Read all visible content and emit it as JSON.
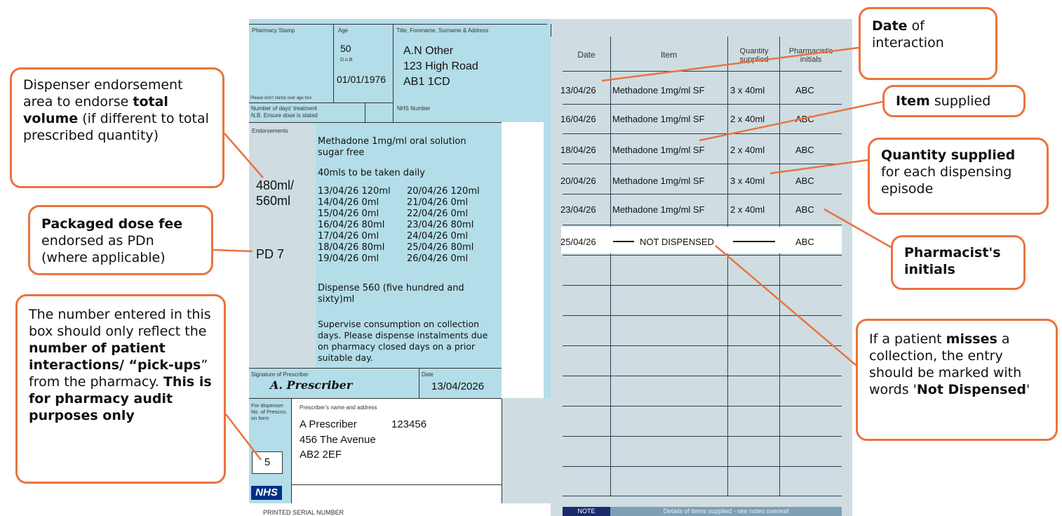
{
  "form": {
    "pharmacy_stamp_label": "Pharmacy Stamp",
    "age_label": "Age",
    "age": "50",
    "dob_label": "D.o.B",
    "dob": "01/01/1976",
    "stamp_note": "Please don't stamp over age box",
    "patient_label": "Title, Forename, Surname & Address",
    "patient_name": "A.N Other",
    "patient_addr1": "123 High Road",
    "patient_addr2": "AB1 1CD",
    "days_label_1": "Number of days' treatment",
    "days_label_2": "N.B. Ensure dose is stated",
    "nhs_number_label": "NHS Number",
    "endorsements_label": "Endorsements",
    "endorse_volume_1": "480ml/",
    "endorse_volume_2": "560ml",
    "endorse_pd": "PD 7",
    "rx_drug": "Methadone 1mg/ml oral solution sugar free",
    "rx_dose": "40mls to be taken daily",
    "schedule_left": [
      "13/04/26 120ml",
      "14/04/26 0ml",
      "15/04/26 0ml",
      "16/04/26 80ml",
      "17/04/26 0ml",
      "18/04/26 80ml",
      "19/04/26 0ml"
    ],
    "schedule_right": [
      "20/04/26 120ml",
      "21/04/26 0ml",
      "22/04/26 0ml",
      "23/04/26 80ml",
      "24/04/26 0ml",
      "25/04/26 80ml",
      "26/04/26 0ml"
    ],
    "rx_total": "Dispense 560 (five hundred and sixty)ml",
    "rx_instructions": "Supervise consumption on collection days. Please dispense instalments due on pharmacy closed days on a prior suitable day.",
    "signature_label": "Signature of Prescriber",
    "signature": "A. Prescriber",
    "date_label": "Date",
    "date": "13/04/2026",
    "dispenser_label": "For dispenser No. of Prescns. on form",
    "prescns_count": "5",
    "prescriber_label": "Prescriber's name and address",
    "prescriber_name": "A Prescriber",
    "prescriber_code": "123456",
    "prescriber_addr1": "456 The Avenue",
    "prescriber_addr2": "AB2 2EF",
    "nhs_logo": "NHS",
    "serial_label": "PRINTED SERIAL NUMBER"
  },
  "log": {
    "headers": [
      "Date",
      "Item",
      "Quantity supplied",
      "Pharmacist's initials"
    ],
    "rows": [
      {
        "date": "13/04/26",
        "item": "Methadone 1mg/ml SF",
        "qty": "3 x 40ml",
        "initials": "ABC"
      },
      {
        "date": "16/04/26",
        "item": "Methadone 1mg/ml SF",
        "qty": "2 x 40ml",
        "initials": "ABC"
      },
      {
        "date": "18/04/26",
        "item": "Methadone 1mg/ml SF",
        "qty": "2 x 40ml",
        "initials": "ABC"
      },
      {
        "date": "20/04/26",
        "item": "Methadone 1mg/ml SF",
        "qty": "3 x 40ml",
        "initials": "ABC"
      },
      {
        "date": "23/04/26",
        "item": "Methadone 1mg/ml SF",
        "qty": "2 x 40ml",
        "initials": "ABC"
      },
      {
        "date": "25/04/26",
        "item": "NOT DISPENSED",
        "qty": "",
        "initials": "ABC"
      }
    ],
    "note_label": "NOTE",
    "note_text": "Details of items supplied - see notes overleaf"
  },
  "callouts": {
    "endorse_pre": "Dispenser endorsement area to endorse ",
    "endorse_bold": "total volume",
    "endorse_post": " (if different to total prescribed quantity)",
    "pd_bold": "Packaged dose fee",
    "pd_post": " endorsed as PDn (where applicable)",
    "count_pre": "The number entered in this box should only reflect the ",
    "count_bold": "number of patient interactions/ “pick-ups",
    "count_mid": "” from the pharmacy. ",
    "count_bold2": "This is for pharmacy audit purposes only",
    "date_bold": "Date",
    "date_post": " of interaction",
    "item_bold": "Item",
    "item_post": " supplied",
    "qty_bold": "Quantity supplied",
    "qty_post": " for each dispensing episode",
    "initials_bold": "Pharmacist's initials",
    "missed_pre": "If a patient ",
    "missed_bold": "misses",
    "missed_mid": " a collection, the entry should be marked with words '",
    "missed_bold2": "Not Dispensed",
    "missed_post": "'"
  },
  "colors": {
    "form_blue": "#b3dde8",
    "form_grey": "#cfdde2",
    "callout_orange": "#e9743d",
    "nhs_blue": "#003087"
  }
}
